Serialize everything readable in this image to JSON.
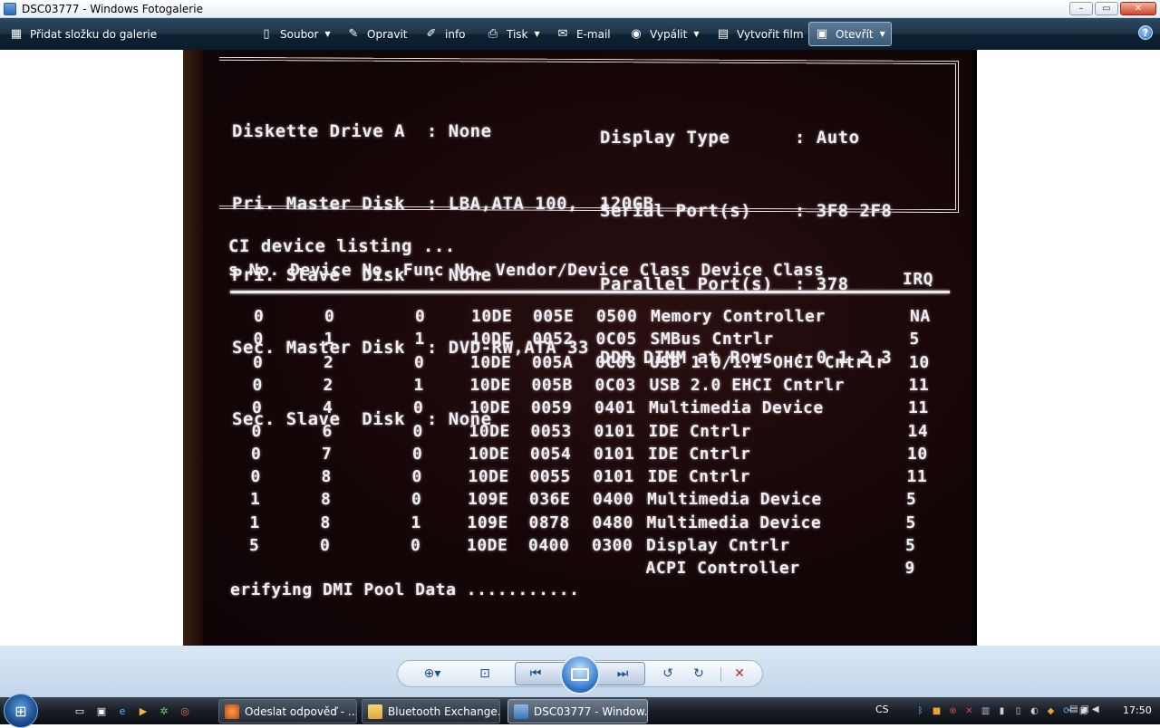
{
  "window": {
    "title": "DSC03777 - Windows Fotogalerie",
    "minimize": "–",
    "maximize": "▭",
    "close": "✕"
  },
  "toolbar": {
    "add_folder": "Přidat složku do galerie",
    "file": "Soubor",
    "fix": "Opravit",
    "info": "info",
    "print": "Tisk",
    "email": "E-mail",
    "burn": "Vypálit",
    "movie": "Vytvořit film",
    "open": "Otevřít",
    "help": "?"
  },
  "photo": {
    "left_col": [
      "Diskette Drive A  : None",
      "Pri. Master Disk  : LBA,ATA 100,  120GB",
      "Pri. Slave  Disk  : None",
      "Sec. Master Disk  : DVD-RW,ATA 33",
      "Sec. Slave  Disk  : None"
    ],
    "right_col": [
      "Display Type      : Auto",
      "Serial Port(s)    : 3F8 2F8",
      "Parallel Port(s)  : 378",
      "DDR DIMM at Rows  : 0 1 2 3"
    ],
    "pci_title": "CI device listing ...",
    "pci_header": "s No. Device No. Func No. Vendor/Device Class Device Class",
    "irq_header": "IRQ",
    "rows": [
      {
        "bus": "0",
        "dev": "0",
        "func": "0",
        "vendor": "10DE",
        "device": "005E",
        "cls": "0500",
        "name": "Memory Controller",
        "irq": "NA"
      },
      {
        "bus": "0",
        "dev": "1",
        "func": "1",
        "vendor": "10DE",
        "device": "0052",
        "cls": "0C05",
        "name": "SMBus Cntrlr",
        "irq": "5"
      },
      {
        "bus": "0",
        "dev": "2",
        "func": "0",
        "vendor": "10DE",
        "device": "005A",
        "cls": "0C03",
        "name": "USB 1.0/1.1 OHCI Cntrlr",
        "irq": "10"
      },
      {
        "bus": "0",
        "dev": "2",
        "func": "1",
        "vendor": "10DE",
        "device": "005B",
        "cls": "0C03",
        "name": "USB 2.0 EHCI Cntrlr",
        "irq": "11"
      },
      {
        "bus": "0",
        "dev": "4",
        "func": "0",
        "vendor": "10DE",
        "device": "0059",
        "cls": "0401",
        "name": "Multimedia Device",
        "irq": "11"
      },
      {
        "bus": "0",
        "dev": "6",
        "func": "0",
        "vendor": "10DE",
        "device": "0053",
        "cls": "0101",
        "name": "IDE Cntrlr",
        "irq": "14"
      },
      {
        "bus": "0",
        "dev": "7",
        "func": "0",
        "vendor": "10DE",
        "device": "0054",
        "cls": "0101",
        "name": "IDE Cntrlr",
        "irq": "10"
      },
      {
        "bus": "0",
        "dev": "8",
        "func": "0",
        "vendor": "10DE",
        "device": "0055",
        "cls": "0101",
        "name": "IDE Cntrlr",
        "irq": "11"
      },
      {
        "bus": "1",
        "dev": "8",
        "func": "0",
        "vendor": "109E",
        "device": "036E",
        "cls": "0400",
        "name": "Multimedia Device",
        "irq": "5"
      },
      {
        "bus": "1",
        "dev": "8",
        "func": "1",
        "vendor": "109E",
        "device": "0878",
        "cls": "0480",
        "name": "Multimedia Device",
        "irq": "5"
      },
      {
        "bus": "5",
        "dev": "0",
        "func": "0",
        "vendor": "10DE",
        "device": "0400",
        "cls": "0300",
        "name": "Display Cntrlr",
        "irq": "5"
      },
      {
        "bus": "",
        "dev": "",
        "func": "",
        "vendor": "",
        "device": "",
        "cls": "",
        "name": "ACPI Controller",
        "irq": "9"
      }
    ],
    "footer": "erifying DMI Pool Data ..........."
  },
  "taskbar": {
    "tasks": [
      "Odeslat odpověď - ...",
      "Bluetooth Exchange...",
      "DSC03777 - Window..."
    ],
    "language": "CS",
    "clock": "17:50"
  }
}
